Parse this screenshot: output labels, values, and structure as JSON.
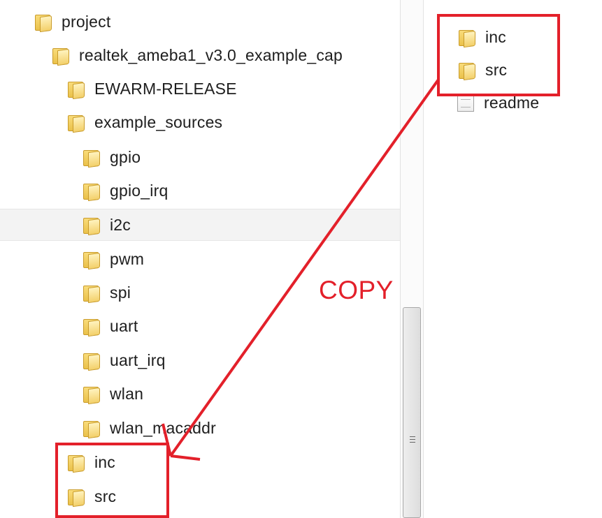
{
  "tree": {
    "items": [
      {
        "label": "project",
        "icon": "folder-icon"
      },
      {
        "label": "realtek_ameba1_v3.0_example_cap",
        "icon": "folder-icon"
      },
      {
        "label": "EWARM-RELEASE",
        "icon": "folder-icon"
      },
      {
        "label": "example_sources",
        "icon": "folder-icon"
      },
      {
        "label": "gpio",
        "icon": "folder-icon"
      },
      {
        "label": "gpio_irq",
        "icon": "folder-icon"
      },
      {
        "label": "i2c",
        "icon": "folder-icon",
        "selected": true
      },
      {
        "label": "pwm",
        "icon": "folder-icon"
      },
      {
        "label": "spi",
        "icon": "folder-icon"
      },
      {
        "label": "uart",
        "icon": "folder-icon"
      },
      {
        "label": "uart_irq",
        "icon": "folder-icon"
      },
      {
        "label": "wlan",
        "icon": "folder-icon"
      },
      {
        "label": "wlan_macaddr",
        "icon": "folder-icon"
      },
      {
        "label": "inc",
        "icon": "folder-icon"
      },
      {
        "label": "src",
        "icon": "folder-icon"
      }
    ]
  },
  "right_pane": {
    "items": [
      {
        "label": "inc",
        "icon": "folder-icon"
      },
      {
        "label": "src",
        "icon": "folder-icon"
      },
      {
        "label": "readme",
        "icon": "file-icon"
      }
    ]
  },
  "annotation": {
    "copy_label": "COPY",
    "color": "#e3202a"
  },
  "colors": {
    "background": "#ffffff",
    "selected_row": "#f3f3f3",
    "folder": "#f3d06a",
    "text": "#1e1e1e"
  }
}
